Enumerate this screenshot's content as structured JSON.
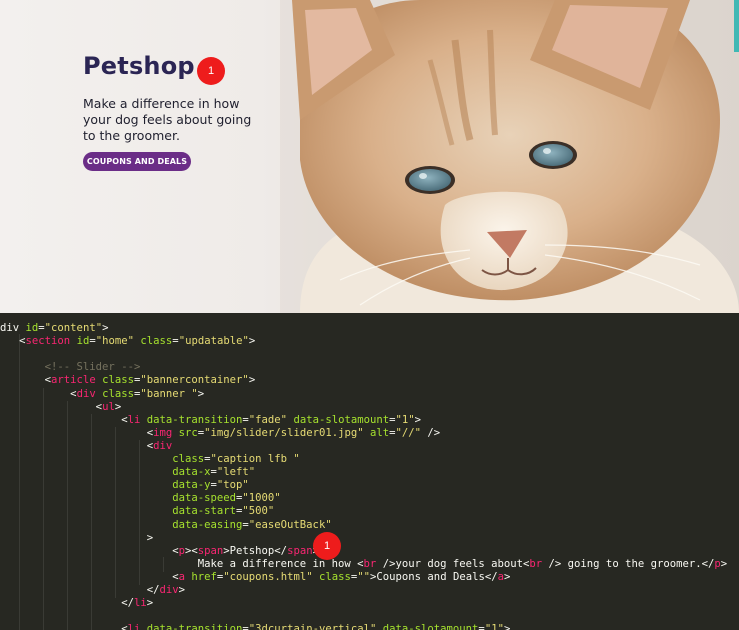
{
  "hero": {
    "title": "Petshop",
    "badge": "1",
    "tagline": "Make a difference in how your dog feels about going to the groomer.",
    "button_label": "COUPONS AND DEALS",
    "colors": {
      "title": "#2b2554",
      "button": "#6b2d87",
      "badge": "#ee1c1c",
      "scroll_accent": "#3fb8b4"
    },
    "photo": "cat-photo"
  },
  "editor": {
    "badge": "1",
    "theme": {
      "background": "#272822",
      "tag": "#f92672",
      "attr": "#a6e22e",
      "string": "#e6db74",
      "comment": "#75715e",
      "text": "#f8f8f2"
    },
    "lines": [
      {
        "indent": "",
        "tokens": [
          [
            "w",
            "div "
          ],
          [
            "a",
            "id"
          ],
          [
            "w",
            "="
          ],
          [
            "s",
            "\"content\""
          ],
          [
            "w",
            ">"
          ]
        ]
      },
      {
        "indent": "   ",
        "tokens": [
          [
            "w",
            "<"
          ],
          [
            "t",
            "section"
          ],
          [
            "w",
            " "
          ],
          [
            "a",
            "id"
          ],
          [
            "w",
            "="
          ],
          [
            "s",
            "\"home\""
          ],
          [
            "w",
            " "
          ],
          [
            "a",
            "class"
          ],
          [
            "w",
            "="
          ],
          [
            "s",
            "\"updatable\""
          ],
          [
            "w",
            ">"
          ]
        ]
      },
      {
        "indent": "",
        "tokens": []
      },
      {
        "indent": "       ",
        "tokens": [
          [
            "c",
            "<!-- Slider -->"
          ]
        ]
      },
      {
        "indent": "       ",
        "tokens": [
          [
            "w",
            "<"
          ],
          [
            "t",
            "article"
          ],
          [
            "w",
            " "
          ],
          [
            "a",
            "class"
          ],
          [
            "w",
            "="
          ],
          [
            "s",
            "\"bannercontainer\""
          ],
          [
            "w",
            ">"
          ]
        ]
      },
      {
        "indent": "           ",
        "tokens": [
          [
            "w",
            "<"
          ],
          [
            "t",
            "div"
          ],
          [
            "w",
            " "
          ],
          [
            "a",
            "class"
          ],
          [
            "w",
            "="
          ],
          [
            "s",
            "\"banner \""
          ],
          [
            "w",
            ">"
          ]
        ]
      },
      {
        "indent": "               ",
        "tokens": [
          [
            "w",
            "<"
          ],
          [
            "t",
            "ul"
          ],
          [
            "w",
            ">"
          ]
        ]
      },
      {
        "indent": "                   ",
        "tokens": [
          [
            "w",
            "<"
          ],
          [
            "t",
            "li"
          ],
          [
            "w",
            " "
          ],
          [
            "a",
            "data-transition"
          ],
          [
            "w",
            "="
          ],
          [
            "s",
            "\"fade\""
          ],
          [
            "w",
            " "
          ],
          [
            "a",
            "data-slotamount"
          ],
          [
            "w",
            "="
          ],
          [
            "s",
            "\"1\""
          ],
          [
            "w",
            ">"
          ]
        ]
      },
      {
        "indent": "                       ",
        "tokens": [
          [
            "w",
            "<"
          ],
          [
            "t",
            "img"
          ],
          [
            "w",
            " "
          ],
          [
            "a",
            "src"
          ],
          [
            "w",
            "="
          ],
          [
            "s",
            "\"img/slider/slider01.jpg\""
          ],
          [
            "w",
            " "
          ],
          [
            "a",
            "alt"
          ],
          [
            "w",
            "="
          ],
          [
            "s",
            "\"//\""
          ],
          [
            "w",
            " />"
          ]
        ]
      },
      {
        "indent": "                       ",
        "tokens": [
          [
            "w",
            "<"
          ],
          [
            "t",
            "div"
          ]
        ]
      },
      {
        "indent": "                           ",
        "tokens": [
          [
            "a",
            "class"
          ],
          [
            "w",
            "="
          ],
          [
            "s",
            "\"caption lfb \""
          ]
        ]
      },
      {
        "indent": "                           ",
        "tokens": [
          [
            "a",
            "data-x"
          ],
          [
            "w",
            "="
          ],
          [
            "s",
            "\"left\""
          ]
        ]
      },
      {
        "indent": "                           ",
        "tokens": [
          [
            "a",
            "data-y"
          ],
          [
            "w",
            "="
          ],
          [
            "s",
            "\"top\""
          ]
        ]
      },
      {
        "indent": "                           ",
        "tokens": [
          [
            "a",
            "data-speed"
          ],
          [
            "w",
            "="
          ],
          [
            "s",
            "\"1000\""
          ]
        ]
      },
      {
        "indent": "                           ",
        "tokens": [
          [
            "a",
            "data-start"
          ],
          [
            "w",
            "="
          ],
          [
            "s",
            "\"500\""
          ]
        ]
      },
      {
        "indent": "                           ",
        "tokens": [
          [
            "a",
            "data-easing"
          ],
          [
            "w",
            "="
          ],
          [
            "s",
            "\"easeOutBack\""
          ]
        ]
      },
      {
        "indent": "                       ",
        "tokens": [
          [
            "w",
            ">"
          ]
        ]
      },
      {
        "indent": "                           ",
        "tokens": [
          [
            "w",
            "<"
          ],
          [
            "t",
            "p"
          ],
          [
            "w",
            "><"
          ],
          [
            "t",
            "span"
          ],
          [
            "w",
            ">Petshop</"
          ],
          [
            "t",
            "span"
          ],
          [
            "w",
            ">"
          ]
        ]
      },
      {
        "indent": "                               ",
        "tokens": [
          [
            "w",
            "Make a difference in how <"
          ],
          [
            "t",
            "br"
          ],
          [
            "w",
            " />your dog feels about<"
          ],
          [
            "t",
            "br"
          ],
          [
            "w",
            " /> going to the groomer.</"
          ],
          [
            "t",
            "p"
          ],
          [
            "w",
            ">"
          ]
        ]
      },
      {
        "indent": "                           ",
        "tokens": [
          [
            "w",
            "<"
          ],
          [
            "t",
            "a"
          ],
          [
            "w",
            " "
          ],
          [
            "a",
            "href"
          ],
          [
            "w",
            "="
          ],
          [
            "s",
            "\"coupons.html\""
          ],
          [
            "w",
            " "
          ],
          [
            "a",
            "class"
          ],
          [
            "w",
            "="
          ],
          [
            "s",
            "\"\""
          ],
          [
            "w",
            ">Coupons and Deals</"
          ],
          [
            "t",
            "a"
          ],
          [
            "w",
            ">"
          ]
        ]
      },
      {
        "indent": "                       ",
        "tokens": [
          [
            "w",
            "</"
          ],
          [
            "t",
            "div"
          ],
          [
            "w",
            ">"
          ]
        ]
      },
      {
        "indent": "                   ",
        "tokens": [
          [
            "w",
            "</"
          ],
          [
            "t",
            "li"
          ],
          [
            "w",
            ">"
          ]
        ]
      },
      {
        "indent": "",
        "tokens": []
      },
      {
        "indent": "                   ",
        "tokens": [
          [
            "w",
            "<"
          ],
          [
            "t",
            "li"
          ],
          [
            "w",
            " "
          ],
          [
            "a",
            "data-transition"
          ],
          [
            "w",
            "="
          ],
          [
            "s",
            "\"3dcurtain-vertical\""
          ],
          [
            "w",
            " "
          ],
          [
            "a",
            "data-slotamount"
          ],
          [
            "w",
            "="
          ],
          [
            "s",
            "\"1\""
          ],
          [
            "w",
            ">"
          ]
        ]
      }
    ]
  }
}
